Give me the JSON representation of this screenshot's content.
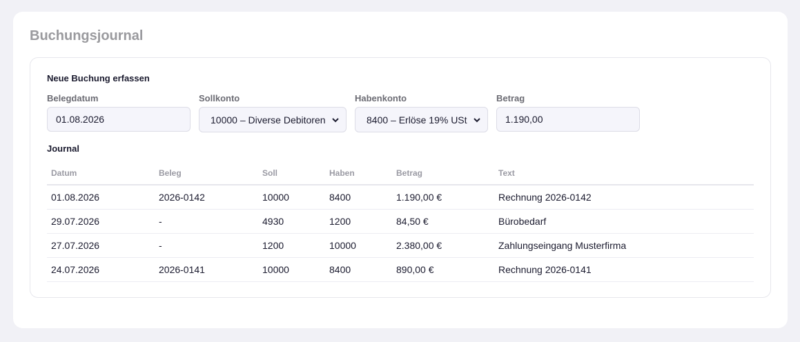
{
  "page": {
    "title": "Buchungsjournal"
  },
  "form": {
    "heading": "Neue Buchung erfassen",
    "belegdatum": {
      "label": "Belegdatum",
      "value": "01.08.2026"
    },
    "sollkonto": {
      "label": "Sollkonto",
      "value": "10000 – Diverse Debitoren"
    },
    "habenkonto": {
      "label": "Habenkonto",
      "value": "8400 – Erlöse 19% USt"
    },
    "betrag": {
      "label": "Betrag",
      "value": "1.190,00"
    }
  },
  "journal": {
    "heading": "Journal",
    "columns": [
      "Datum",
      "Beleg",
      "Soll",
      "Haben",
      "Betrag",
      "Text"
    ],
    "rows": [
      [
        "01.08.2026",
        "2026-0142",
        "10000",
        "8400",
        "1.190,00 €",
        "Rechnung 2026-0142"
      ],
      [
        "29.07.2026",
        "-",
        "4930",
        "1200",
        "84,50 €",
        "Bürobedarf"
      ],
      [
        "27.07.2026",
        "-",
        "1200",
        "10000",
        "2.380,00 €",
        "Zahlungseingang Musterfirma"
      ],
      [
        "24.07.2026",
        "2026-0141",
        "10000",
        "8400",
        "890,00 €",
        "Rechnung 2026-0141"
      ]
    ]
  },
  "icons": {
    "select_arrow": "chevron-down-icon"
  }
}
